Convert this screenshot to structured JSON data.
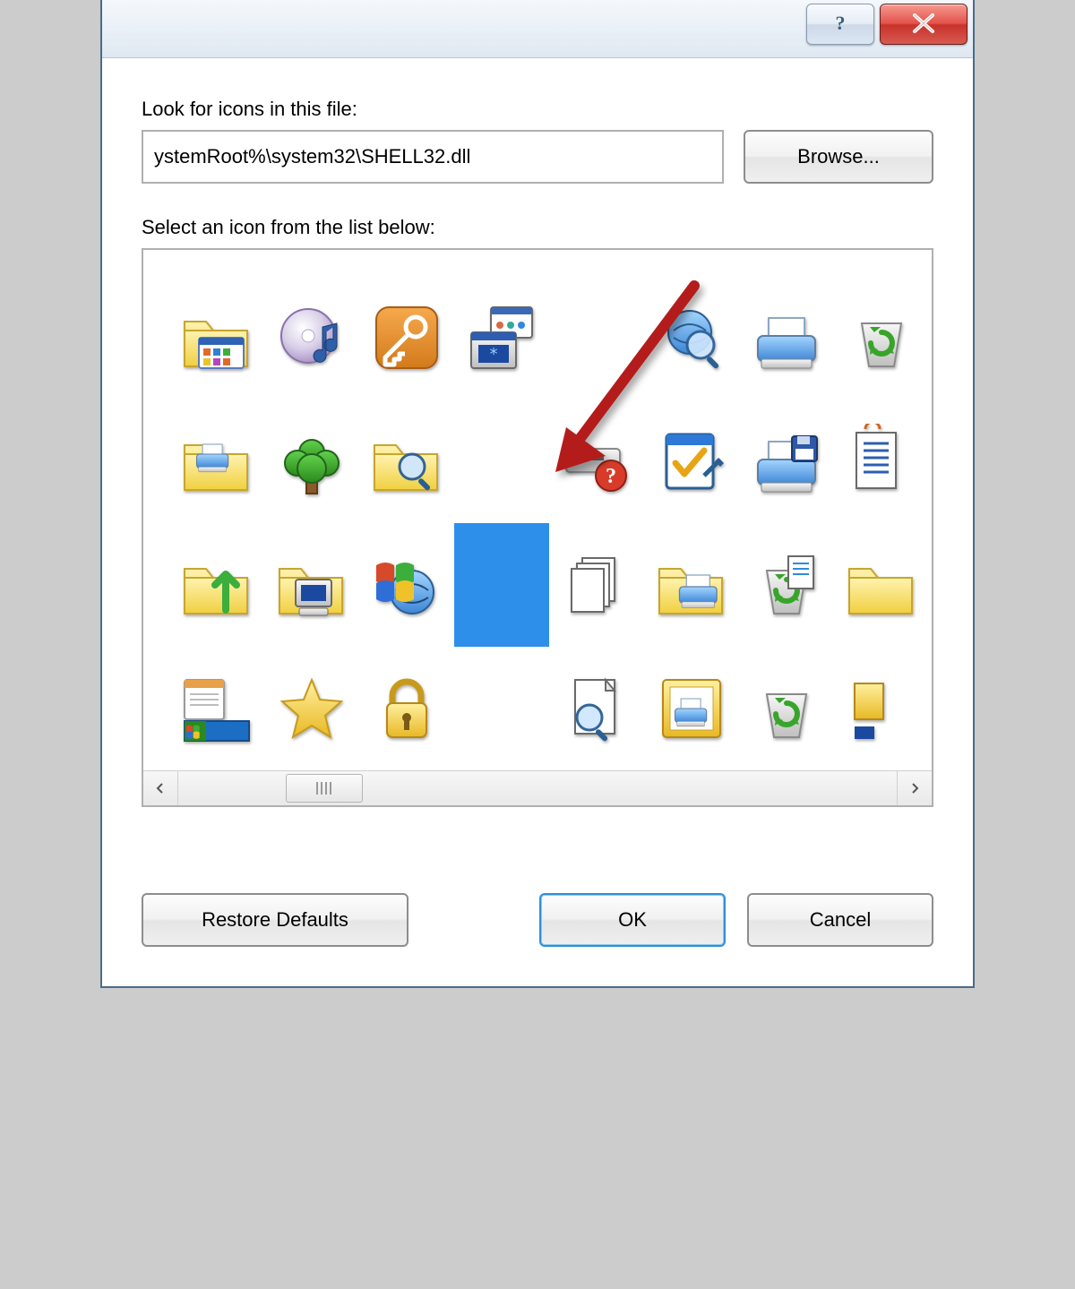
{
  "labels": {
    "look_in": "Look for icons in this file:",
    "select_below": "Select an icon from the list below:"
  },
  "path_value": "ystemRoot%\\system32\\SHELL32.dll",
  "buttons": {
    "browse": "Browse...",
    "restore": "Restore Defaults",
    "ok": "OK",
    "cancel": "Cancel"
  },
  "icons": [
    {
      "name": "folder-with-items-window-icon",
      "type": "folder-window"
    },
    {
      "name": "music-disc-icon",
      "type": "disc-note"
    },
    {
      "name": "key-tile-icon",
      "type": "key-tile"
    },
    {
      "name": "system-config-windows-icon",
      "type": "two-windows"
    },
    {
      "name": "blank-slot",
      "type": "blank"
    },
    {
      "name": "search-globe-icon",
      "type": "search-globe"
    },
    {
      "name": "printer-icon",
      "type": "printer"
    },
    {
      "name": "recycle-overflow-icon",
      "type": "recycle-partial"
    },
    {
      "name": "folder-printer-icon",
      "type": "folder-printer"
    },
    {
      "name": "tree-icon",
      "type": "tree"
    },
    {
      "name": "search-folder-icon",
      "type": "folder-search"
    },
    {
      "name": "blank-slot-2",
      "type": "blank"
    },
    {
      "name": "drive-help-icon",
      "type": "drive-help"
    },
    {
      "name": "checklist-edit-icon",
      "type": "check-edit"
    },
    {
      "name": "printer-floppy-icon",
      "type": "printer-floppy"
    },
    {
      "name": "document-lines-icon",
      "type": "doc-lines-partial"
    },
    {
      "name": "folder-up-icon",
      "type": "folder-up"
    },
    {
      "name": "folder-computer-icon",
      "type": "folder-computer"
    },
    {
      "name": "windows-globe-icon",
      "type": "win-globe"
    },
    {
      "name": "blank-icon-selected",
      "type": "blank"
    },
    {
      "name": "multiple-pages-icon",
      "type": "pages"
    },
    {
      "name": "folder-printer-2-icon",
      "type": "folder-printer2"
    },
    {
      "name": "recycle-document-icon",
      "type": "recycle-doc"
    },
    {
      "name": "folder-overflow-icon",
      "type": "folder-partial"
    },
    {
      "name": "taskbar-icon",
      "type": "taskbar"
    },
    {
      "name": "favorites-star-icon",
      "type": "star"
    },
    {
      "name": "lock-icon",
      "type": "lock"
    },
    {
      "name": "blank-slot-3",
      "type": "blank"
    },
    {
      "name": "find-document-icon",
      "type": "doc-search"
    },
    {
      "name": "picture-frame-print-icon",
      "type": "pic-print"
    },
    {
      "name": "recycle-bin-empty-icon",
      "type": "recycle"
    },
    {
      "name": "misc-overflow-icon",
      "type": "misc-partial"
    }
  ],
  "selected_index": 19
}
